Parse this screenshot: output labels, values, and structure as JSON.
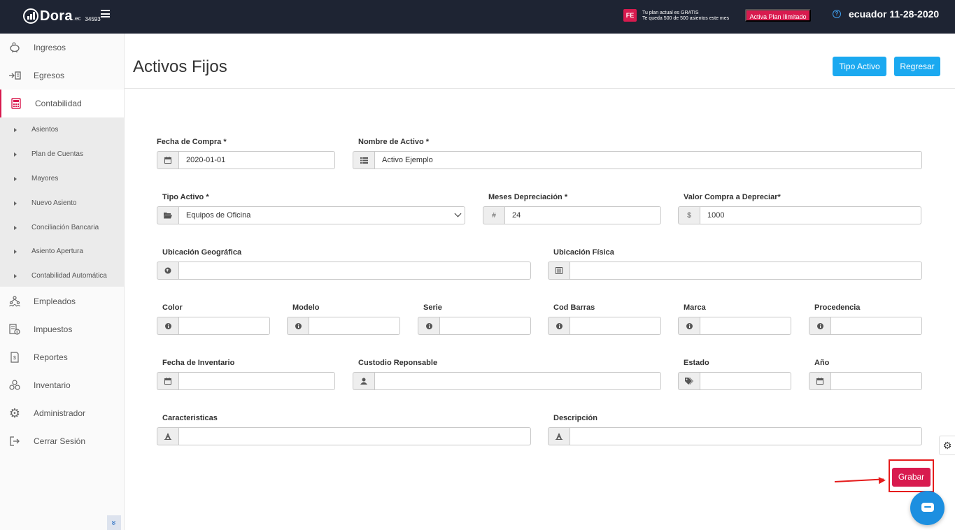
{
  "topbar": {
    "logo_text": "Dora",
    "logo_ec": ".ec",
    "logo_num": "34593",
    "fe_badge": "FE",
    "plan_line1": "Tu plan actual es GRATIS",
    "plan_line2": "Te queda 500 de 500 asientos este mes",
    "activa_label": "Activa Plan Ilimitado",
    "help_symbol": "?",
    "date_text": "ecuador 11-28-2020"
  },
  "sidebar": {
    "items": [
      {
        "label": "Ingresos",
        "icon": "piggy-bank-icon"
      },
      {
        "label": "Egresos",
        "icon": "transfer-icon"
      },
      {
        "label": "Contabilidad",
        "icon": "calculator-icon"
      },
      {
        "label": "Empleados",
        "icon": "employees-icon"
      },
      {
        "label": "Impuestos",
        "icon": "tax-icon"
      },
      {
        "label": "Reportes",
        "icon": "report-icon"
      },
      {
        "label": "Inventario",
        "icon": "inventory-icon"
      },
      {
        "label": "Administrador",
        "icon": "gear-icon"
      },
      {
        "label": "Cerrar Sesión",
        "icon": "logout-icon"
      }
    ],
    "submenu": [
      "Asientos",
      "Plan de Cuentas",
      "Mayores",
      "Nuevo Asiento",
      "Conciliación Bancaria",
      "Asiento Apertura",
      "Contabilidad Automática"
    ],
    "collapse_symbol": "»"
  },
  "page": {
    "title": "Activos Fijos",
    "tipo_activo_btn": "Tipo Activo",
    "regresar_btn": "Regresar"
  },
  "form": {
    "fecha_compra": {
      "label": "Fecha de Compra *",
      "value": "2020-01-01"
    },
    "nombre_activo": {
      "label": "Nombre de Activo *",
      "value": "Activo Ejemplo"
    },
    "tipo_activo": {
      "label": "Tipo Activo *",
      "value": "Equipos de Oficina"
    },
    "meses_depreciacion": {
      "label": "Meses Depreciación *",
      "value": "24",
      "addon": "#"
    },
    "valor_compra": {
      "label": "Valor Compra a Depreciar*",
      "value": "1000",
      "addon": "$"
    },
    "ubicacion_geografica": {
      "label": "Ubicación Geográfica",
      "value": ""
    },
    "ubicacion_fisica": {
      "label": "Ubicación Física",
      "value": ""
    },
    "color": {
      "label": "Color",
      "value": ""
    },
    "modelo": {
      "label": "Modelo",
      "value": ""
    },
    "serie": {
      "label": "Serie",
      "value": ""
    },
    "cod_barras": {
      "label": "Cod Barras",
      "value": ""
    },
    "marca": {
      "label": "Marca",
      "value": ""
    },
    "procedencia": {
      "label": "Procedencia",
      "value": ""
    },
    "fecha_inventario": {
      "label": "Fecha de Inventario",
      "value": ""
    },
    "custodio": {
      "label": "Custodio Reponsable",
      "value": ""
    },
    "estado": {
      "label": "Estado",
      "value": ""
    },
    "anio": {
      "label": "Año",
      "value": ""
    },
    "caracteristicas": {
      "label": "Caracteristicas",
      "value": ""
    },
    "descripcion": {
      "label": "Descripción",
      "value": ""
    },
    "grabar_btn": "Grabar"
  },
  "colors": {
    "topbar": "#1e2433",
    "accent_pink": "#d81b4f",
    "accent_blue": "#1ba9f0",
    "annotation_red": "#e51c1c"
  }
}
